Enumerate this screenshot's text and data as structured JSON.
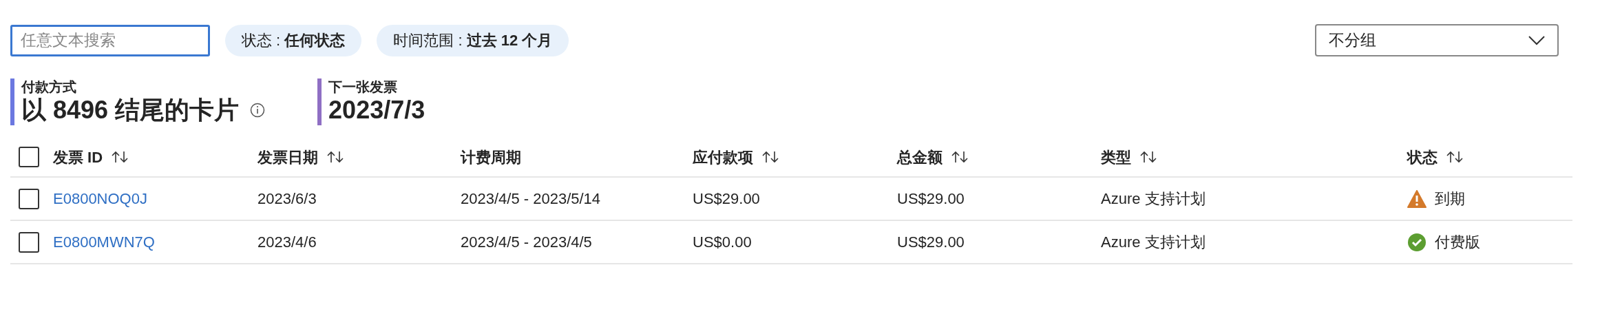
{
  "search": {
    "placeholder": "任意文本搜索"
  },
  "filters": [
    {
      "label": "状态 : ",
      "value": "任何状态"
    },
    {
      "label": "时间范围 : ",
      "value": "过去 12 个月"
    }
  ],
  "grouping": {
    "value": "不分组"
  },
  "summary": [
    {
      "label": "付款方式",
      "value": "以 8496 结尾的卡片",
      "color": "#6b78e0",
      "info": true
    },
    {
      "label": "下一张发票",
      "value": "2023/7/3",
      "color": "#8f6fc4",
      "info": false
    }
  ],
  "table": {
    "select_all": {
      "checked": false
    },
    "columns": [
      {
        "label": "发票 ID",
        "sortable": true
      },
      {
        "label": "发票日期",
        "sortable": true
      },
      {
        "label": "计费周期",
        "sortable": false
      },
      {
        "label": "应付款项",
        "sortable": true
      },
      {
        "label": "总金额",
        "sortable": true
      },
      {
        "label": "类型",
        "sortable": true
      },
      {
        "label": "状态",
        "sortable": true
      }
    ],
    "rows": [
      {
        "checked": false,
        "cells": [
          "E0800NOQ0J",
          "2023/6/3",
          "2023/4/5 - 2023/5/14",
          "US$29.00",
          "US$29.00",
          "Azure 支持计划"
        ],
        "status": {
          "kind": "warning",
          "label": "到期"
        }
      },
      {
        "checked": false,
        "cells": [
          "E0800MWN7Q",
          "2023/4/6",
          "2023/4/5 - 2023/4/5",
          "US$0.00",
          "US$29.00",
          "Azure 支持计划"
        ],
        "status": {
          "kind": "success",
          "label": "付费版"
        }
      }
    ]
  }
}
